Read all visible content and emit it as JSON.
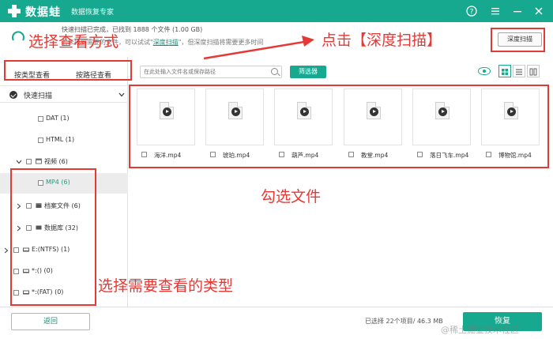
{
  "titlebar": {
    "app_name": "数据蛙",
    "subtitle": "数据恢复专家",
    "help_icon": "help-icon",
    "menu_icon": "menu-icon",
    "minimize_icon": "minimize-icon",
    "close_icon": "close-icon"
  },
  "infobar": {
    "scan_summary": "快速扫描已完成，已找到 1888 个文件 (1.00 GB)",
    "scan_hint_prefix": "若未找到需要的文件，可以试试\"",
    "scan_hint_link": "深度扫描",
    "scan_hint_suffix": "\"，但深度扫描将需要更多时间",
    "deep_scan_label": "深度扫描"
  },
  "sidebar": {
    "tab_by_type": "按类型查看",
    "tab_by_path": "按路径查看",
    "quick_scan_label": "快速扫描",
    "items": [
      {
        "label": "DAT (1)",
        "icon": "folder-icon"
      },
      {
        "label": "HTML (1)",
        "icon": "folder-icon"
      },
      {
        "label": "视频 (6)",
        "icon": "video-icon"
      },
      {
        "label": "MP4 (6)",
        "icon": "folder-icon"
      },
      {
        "label": "档案文件 (6)",
        "icon": "archive-icon"
      },
      {
        "label": "数据库 (32)",
        "icon": "database-icon"
      },
      {
        "label": "E:(NTFS) (1)",
        "icon": "drive-icon"
      },
      {
        "label": "*:() (0)",
        "icon": "drive-icon"
      },
      {
        "label": "*:(FAT) (0)",
        "icon": "drive-icon"
      }
    ]
  },
  "toolbar": {
    "search_placeholder": "在此处输入文件名或保存路径",
    "filter_label": "筛选器"
  },
  "files": [
    {
      "name": "海洋.mp4"
    },
    {
      "name": "琥珀.mp4"
    },
    {
      "name": "葫芦.mp4"
    },
    {
      "name": "教堂.mp4"
    },
    {
      "name": "落日飞车.mp4"
    },
    {
      "name": "博物馆.mp4"
    }
  ],
  "bottombar": {
    "back_label": "返回",
    "selected_info": "已选择 22个项目/ 46.3 MB",
    "recover_label": "恢复",
    "watermark": "@稀土掘金技术社区"
  },
  "annotations": {
    "choose_view": "选择查看方式",
    "click_deep": "点击【深度扫描】",
    "tick_files": "勾选文件",
    "choose_type": "选择需要查看的类型"
  },
  "colors": {
    "brand": "#17a98f",
    "annotation": "#e53935"
  }
}
